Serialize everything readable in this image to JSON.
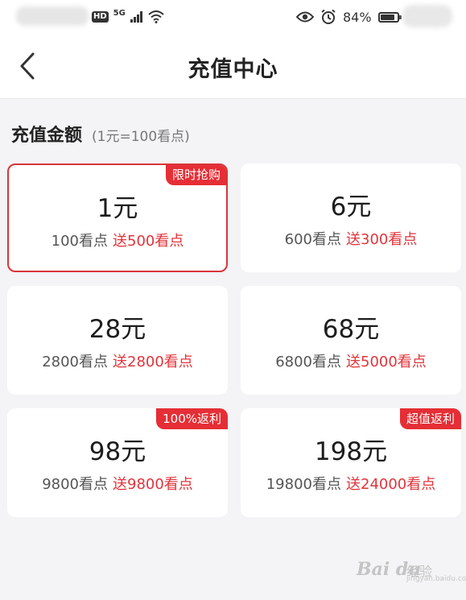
{
  "status_bar": {
    "network_type": "5G",
    "hd_badge": "HD",
    "battery_percent": "84%",
    "battery_level": 0.84
  },
  "nav": {
    "title": "充值中心",
    "back_icon": "chevron-left-icon"
  },
  "section": {
    "title": "充值金额",
    "subtitle": "(1元=100看点)"
  },
  "options": [
    {
      "price": "1元",
      "points": "100看点",
      "bonus": "送500看点",
      "badge": "限时抢购",
      "selected": true
    },
    {
      "price": "6元",
      "points": "600看点",
      "bonus": "送300看点",
      "badge": "",
      "selected": false
    },
    {
      "price": "28元",
      "points": "2800看点",
      "bonus": "送2800看点",
      "badge": "",
      "selected": false
    },
    {
      "price": "68元",
      "points": "6800看点",
      "bonus": "送5000看点",
      "badge": "",
      "selected": false
    },
    {
      "price": "98元",
      "points": "9800看点",
      "bonus": "送9800看点",
      "badge": "100%返利",
      "selected": false
    },
    {
      "price": "198元",
      "points": "19800看点",
      "bonus": "送24000看点",
      "badge": "超值返利",
      "selected": false
    }
  ],
  "watermark": {
    "text": "Bai du",
    "cn": "经验",
    "url": "jingyan.baidu.com"
  },
  "colors": {
    "accent": "#e52e35",
    "background": "#f4f4f6",
    "card": "#ffffff"
  }
}
